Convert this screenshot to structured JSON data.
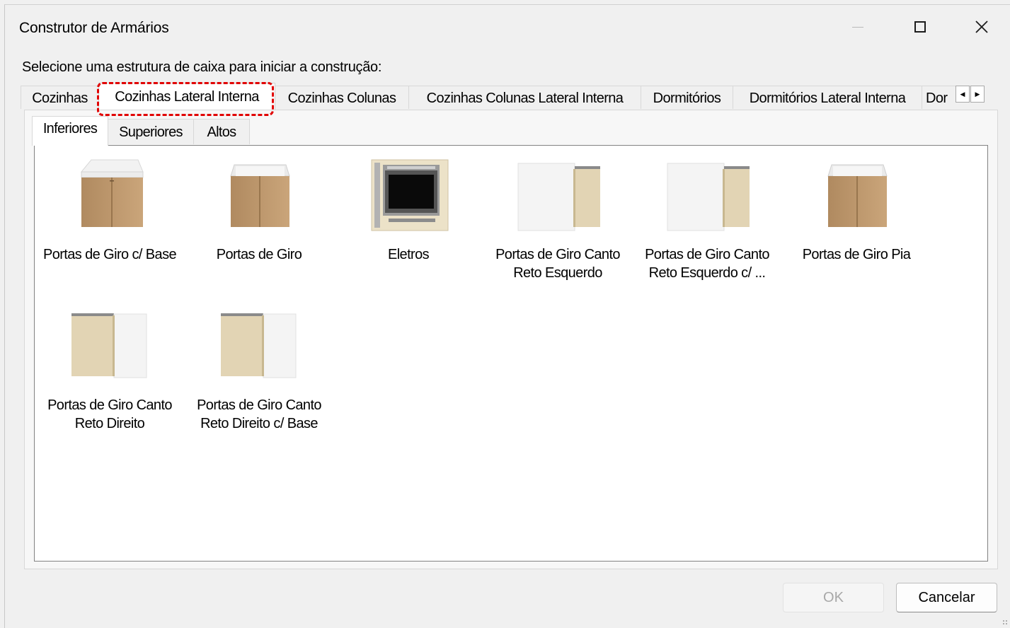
{
  "window": {
    "title": "Construtor de Armários"
  },
  "prompt": "Selecione uma estrutura de caixa para iniciar a construção:",
  "category_tabs": [
    {
      "label": "Cozinhas"
    },
    {
      "label": "Cozinhas Lateral Interna",
      "active": true,
      "highlighted": true
    },
    {
      "label": "Cozinhas Colunas"
    },
    {
      "label": "Cozinhas Colunas Lateral Interna"
    },
    {
      "label": "Dormitórios"
    },
    {
      "label": "Dormitórios Lateral Interna"
    },
    {
      "label": "Dor"
    }
  ],
  "sub_tabs": [
    {
      "label": "Inferiores",
      "active": true
    },
    {
      "label": "Superiores"
    },
    {
      "label": "Altos"
    }
  ],
  "items": [
    {
      "label": "Portas de Giro c/ Base",
      "thumb": "base-cabinet-with-top"
    },
    {
      "label": "Portas de Giro",
      "thumb": "base-cabinet"
    },
    {
      "label": "Eletros",
      "thumb": "oven-cabinet"
    },
    {
      "label": "Portas de Giro Canto Reto Esquerdo",
      "thumb": "corner-cabinet-left"
    },
    {
      "label": "Portas de Giro Canto Reto Esquerdo c/ ...",
      "thumb": "corner-cabinet-left-base"
    },
    {
      "label": "Portas de Giro Pia",
      "thumb": "sink-cabinet"
    },
    {
      "label": "Portas de Giro Canto Reto Direito",
      "thumb": "corner-cabinet-right"
    },
    {
      "label": "Portas de Giro Canto Reto Direito c/ Base",
      "thumb": "corner-cabinet-right-base"
    }
  ],
  "buttons": {
    "ok": "OK",
    "cancel": "Cancelar"
  },
  "colors": {
    "highlight": "#e10000",
    "wood": "#c9a477",
    "panel": "#f0f0f0"
  }
}
